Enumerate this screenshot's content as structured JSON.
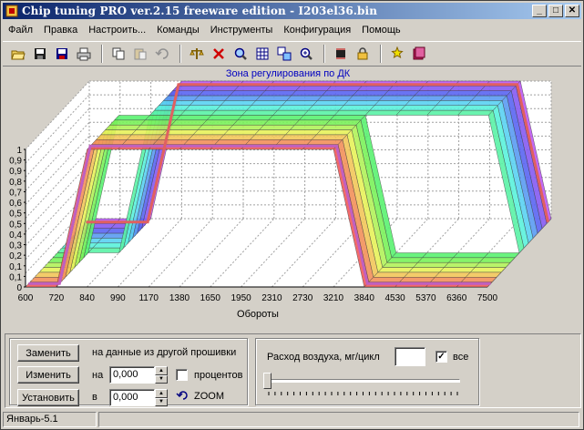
{
  "window": {
    "title": "Chip tuning PRO ver.2.15 freeware edition  -  I203el36.bin",
    "minimize_glyph": "_",
    "maximize_glyph": "□",
    "close_glyph": "✕"
  },
  "menu": [
    "Файл",
    "Правка",
    "Настроить...",
    "Команды",
    "Инструменты",
    "Конфигурация",
    "Помощь"
  ],
  "toolbar_icons": [
    "open-icon",
    "save-icon",
    "save-as-icon",
    "print-icon",
    "copy-icon",
    "paste-icon",
    "undo-icon",
    "scales-icon",
    "clear-icon",
    "search-icon",
    "table-icon",
    "compare-icon",
    "zoom-icon",
    "chip-icon",
    "lock-icon",
    "wizard-icon",
    "book-icon"
  ],
  "chart": {
    "title": "Зона регулирования по ДК",
    "x_label": "Обороты",
    "title_color": "#0000c0",
    "background": "#ffffff"
  },
  "chart_data": {
    "type": "3d-surface",
    "title": "Зона регулирования по ДК",
    "xlabel": "Обороты",
    "ylabel": "",
    "x_ticks": [
      "600",
      "720",
      "840",
      "990",
      "1170",
      "1380",
      "1650",
      "1950",
      "2310",
      "2730",
      "3210",
      "3840",
      "4530",
      "5370",
      "6360",
      "7500"
    ],
    "z_ticks": [
      "0",
      "0,1",
      "0,1",
      "0,2",
      "0,3",
      "0,4",
      "0,5",
      "0,5",
      "0,6",
      "0,7",
      "0,8",
      "0,9",
      "0,9",
      "1"
    ],
    "zlim": [
      0,
      1
    ],
    "grid": true,
    "description_values_front_row": [
      0,
      0,
      1,
      1,
      1,
      1,
      1,
      1,
      1,
      1,
      1,
      0,
      0,
      0,
      0,
      0
    ],
    "description_values_back_row": [
      0,
      0,
      0,
      1,
      1,
      1,
      1,
      1,
      1,
      1,
      1,
      1,
      1,
      1,
      1,
      0
    ]
  },
  "controls": {
    "replace_label": "Заменить",
    "change_label": "Изменить",
    "set_label": "Установить",
    "source_text": "на данные из другой прошивки",
    "on_label": "на",
    "on_value": "0,000",
    "in_label": "в",
    "in_value": "0,000",
    "percent_label": "процентов",
    "percent_checked": false,
    "zoom_label": "ZOOM"
  },
  "airflow": {
    "label": "Расход воздуха, мг/цикл",
    "value": "",
    "all_label": "все",
    "all_checked": true
  },
  "status": {
    "left": "Январь-5.1",
    "right": ""
  }
}
